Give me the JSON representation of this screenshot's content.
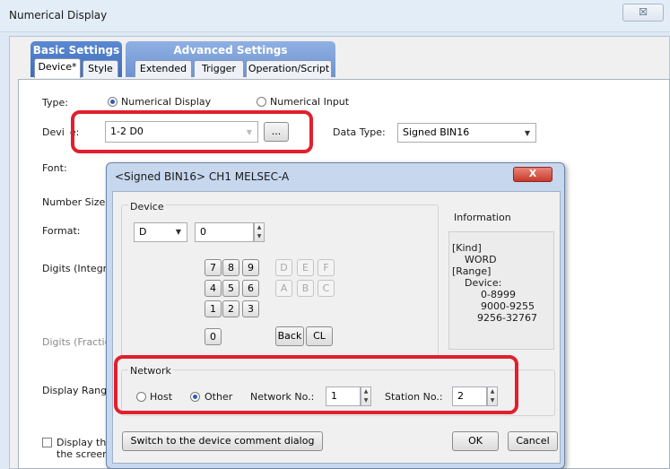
{
  "window": {
    "title": "Numerical Display",
    "close_glyph": "☒"
  },
  "tab_groups": {
    "basic": "Basic Settings",
    "advanced": "Advanced Settings"
  },
  "tabs": [
    "Device*",
    "Style",
    "Extended",
    "Trigger",
    "Operation/Script"
  ],
  "form": {
    "type_label": "Type:",
    "type_options": [
      "Numerical Display",
      "Numerical Input"
    ],
    "device_label_a": "Devi",
    "device_label_b": "e:",
    "device_value": "1-2 D0",
    "browse_label": "...",
    "data_type_label": "Data Type:",
    "data_type_value": "Signed BIN16",
    "font_label": "Font:",
    "number_size_label": "Number Size:",
    "format_label": "Format:",
    "digits_integer_label": "Digits (Integr",
    "digits_fraction_label": "Digits (Fractic",
    "display_range_label": "Display Range",
    "display_the_label": "Display the",
    "the_screen_label": "the screer"
  },
  "dialog": {
    "title": "<Signed BIN16> CH1 MELSEC-A",
    "close_glyph": "X",
    "device_group": "Device",
    "device_type": "D",
    "device_number": "0",
    "keypad_digits": [
      [
        "7",
        "8",
        "9"
      ],
      [
        "4",
        "5",
        "6"
      ],
      [
        "1",
        "2",
        "3"
      ],
      [
        "0"
      ]
    ],
    "keypad_hex": [
      [
        "D",
        "E",
        "F"
      ],
      [
        "A",
        "B",
        "C"
      ]
    ],
    "back_label": "Back",
    "clear_label": "CL",
    "information_label": "Information",
    "info_lines": [
      "[Kind]",
      "WORD",
      "[Range]",
      "Device:",
      "0-8999",
      "9000-9255",
      "9256-32767"
    ],
    "network_group": "Network",
    "network_options": [
      "Host",
      "Other"
    ],
    "network_no_label": "Network No.:",
    "network_no_value": "1",
    "station_no_label": "Station No.:",
    "station_no_value": "2",
    "switch_label": "Switch to the device comment dialog",
    "ok_label": "OK",
    "cancel_label": "Cancel"
  },
  "colors": {
    "highlight": "#e0202d",
    "tab_blue": "#3e6dbd",
    "adv_blue": "#6e93d2"
  }
}
